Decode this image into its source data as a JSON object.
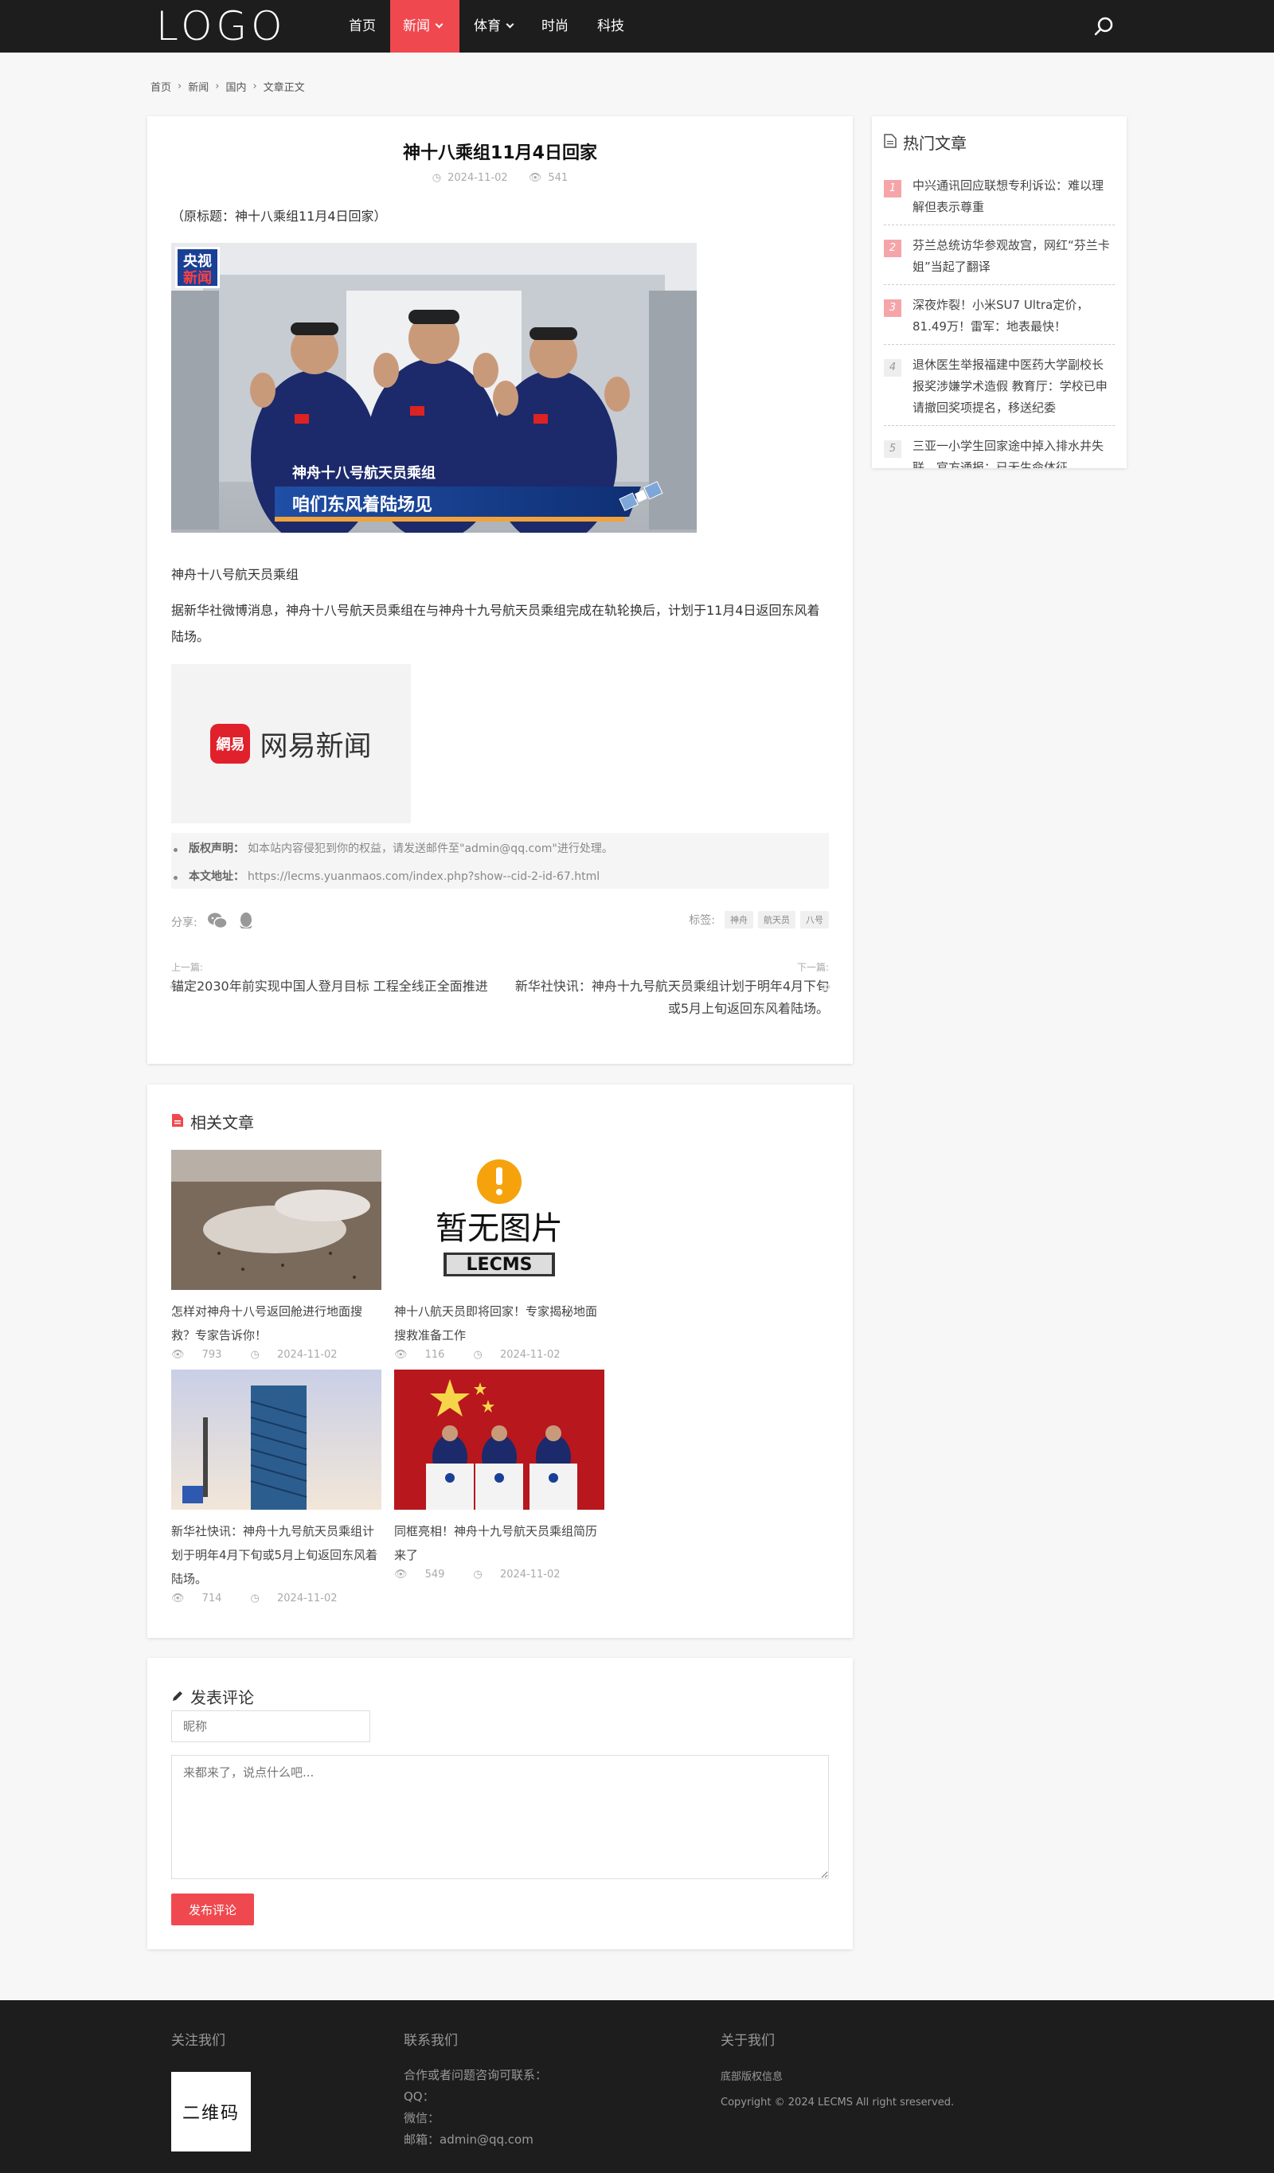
{
  "header": {
    "logo": "LOGO",
    "nav": [
      {
        "label": "首页"
      },
      {
        "label": "新闻"
      },
      {
        "label": "体育"
      },
      {
        "label": "时尚"
      },
      {
        "label": "科技"
      }
    ],
    "accent_color": "#f0484f"
  },
  "breadcrumb": [
    "首页",
    "新闻",
    "国内",
    "文章正文"
  ],
  "article": {
    "title": "神十八乘组11月4日回家",
    "date": "2024-11-02",
    "views": "541",
    "p1": "（原标题：神十八乘组11月4日回家）",
    "photo": {
      "badge_line1": "央视",
      "badge_line2": "新闻",
      "caption_small": "神舟十八号航天员乘组",
      "caption_big": "咱们东风着陆场见"
    },
    "p2": "神舟十八号航天员乘组",
    "p3": "据新华社微博消息，神舟十八号航天员乘组在与神舟十九号航天员乘组完成在轨轮换后，计划于11月4日返回东风着陆场。",
    "netease_logo": "網易",
    "netease_text": "网易新闻",
    "copyright_label": "版权声明：",
    "copyright_text": "如本站内容侵犯到你的权益，请发送邮件至\"admin@qq.com\"进行处理。",
    "url_label": "本文地址：",
    "url_text": "https://lecms.yuanmaos.com/index.php?show--cid-2-id-67.html",
    "share_label": "分享:",
    "tags_label": "标签:",
    "tags": [
      "神舟",
      "航天员",
      "八号"
    ],
    "prev_label": "上一篇:",
    "prev_title": "锚定2030年前实现中国人登月目标 工程全线正全面推进",
    "next_label": "下一篇:",
    "next_title": "新华社快讯：神舟十九号航天员乘组计划于明年4月下旬或5月上旬返回东风着陆场。"
  },
  "related": {
    "title": "相关文章",
    "placeholder_text": "暂无图片",
    "placeholder_brand": "LECMS",
    "items": [
      {
        "title": "怎样对神舟十八号返回舱进行地面搜救？专家告诉你！",
        "views": "793",
        "date": "2024-11-02"
      },
      {
        "title": "神十八航天员即将回家！专家揭秘地面搜救准备工作",
        "views": "116",
        "date": "2024-11-02"
      },
      {
        "title": "新华社快讯：神舟十九号航天员乘组计划于明年4月下旬或5月上旬返回东风着陆场。",
        "views": "714",
        "date": "2024-11-02"
      },
      {
        "title": "同框亮相！神舟十九号航天员乘组简历来了",
        "views": "549",
        "date": "2024-11-02"
      }
    ]
  },
  "comment": {
    "title": "发表评论",
    "nick_placeholder": "昵称",
    "text_placeholder": "来都来了，说点什么吧...",
    "submit": "发布评论"
  },
  "hot": {
    "title": "热门文章",
    "items": [
      {
        "num": "1",
        "title": "中兴通讯回应联想专利诉讼：难以理解但表示尊重"
      },
      {
        "num": "2",
        "title": "芬兰总统访华参观故宫，网红“芬兰卡姐”当起了翻译"
      },
      {
        "num": "3",
        "title": "深夜炸裂！小米SU7 Ultra定价，81.49万！雷军：地表最快！"
      },
      {
        "num": "4",
        "title": "退休医生举报福建中医药大学副校长报奖涉嫌学术造假 教育厅：学校已申请撤回奖项提名，移送纪委"
      },
      {
        "num": "5",
        "title": "三亚一小学生回家途中掉入排水井失联，官方通报：已无生命体征"
      }
    ]
  },
  "footer": {
    "follow_title": "关注我们",
    "qr_text": "二维码",
    "contact_title": "联系我们",
    "contact_lines": [
      "合作或者问题咨询可联系：",
      "QQ：",
      "微信：",
      "邮箱：admin@qq.com"
    ],
    "about_title": "关于我们",
    "about_lines": [
      "底部版权信息",
      "Copyright © 2024 LECMS All right sreserved."
    ]
  }
}
